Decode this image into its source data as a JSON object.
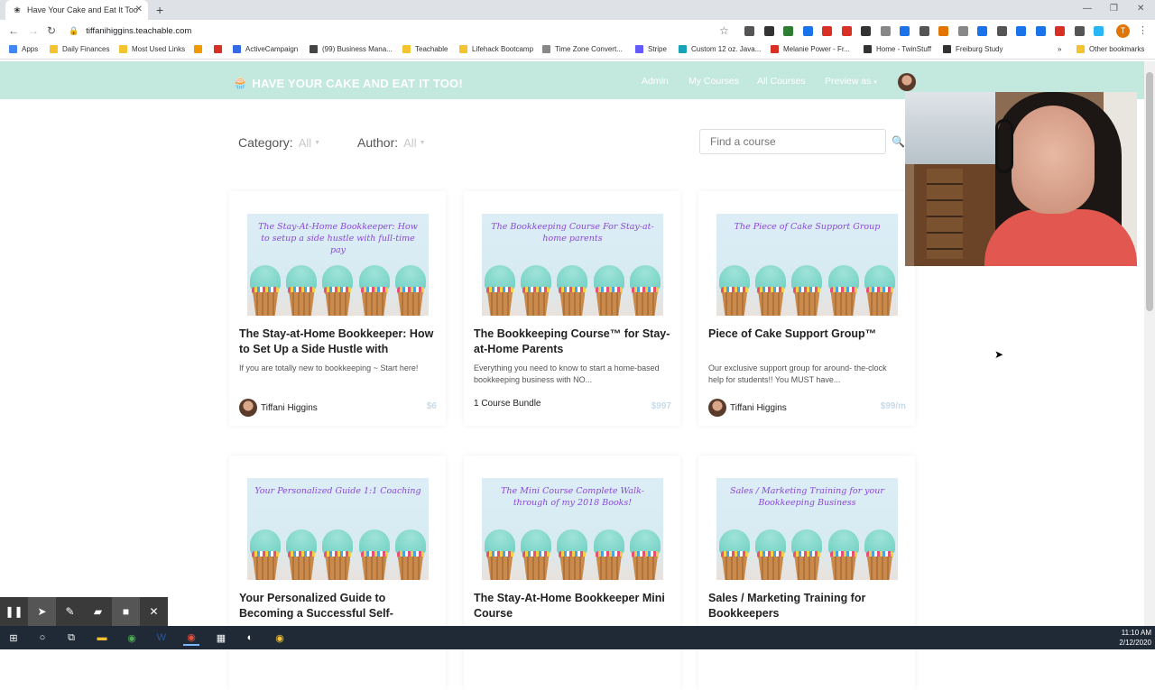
{
  "browser": {
    "tab_title": "Have Your Cake and Eat It Too",
    "url": "tiffanihiggins.teachable.com",
    "profile_initial": "T",
    "bookmarks": [
      {
        "label": "Apps",
        "color": "#4285f4"
      },
      {
        "label": "Daily Finances",
        "color": "#f4c430"
      },
      {
        "label": "Most Used Links",
        "color": "#f4c430"
      },
      {
        "label": "",
        "color": "#f29900"
      },
      {
        "label": "",
        "color": "#d93025"
      },
      {
        "label": "ActiveCampaign",
        "color": "#356ae6"
      },
      {
        "label": "(99) Business Mana...",
        "color": "#444444"
      },
      {
        "label": "Teachable",
        "color": "#f4c430"
      },
      {
        "label": "Lifehack Bootcamp",
        "color": "#f4c430"
      },
      {
        "label": "Time Zone Convert...",
        "color": "#888888"
      },
      {
        "label": "Stripe",
        "color": "#635bff"
      },
      {
        "label": "Custom 12 oz. Java...",
        "color": "#17a2b8"
      },
      {
        "label": "Melanie Power - Fr...",
        "color": "#d93025"
      },
      {
        "label": "Home - TwinStuff",
        "color": "#333333"
      },
      {
        "label": "Freiburg Study",
        "color": "#333333"
      },
      {
        "label": "Other bookmarks",
        "color": "#f4c430"
      }
    ]
  },
  "site": {
    "brand": "HAVE YOUR CAKE AND EAT IT TOO!",
    "nav": [
      "Admin",
      "My Courses",
      "All Courses",
      "Preview as"
    ],
    "accent": "#c3e8de"
  },
  "filters": {
    "category_label": "Category:",
    "category_value": "All",
    "author_label": "Author:",
    "author_value": "All",
    "search_placeholder": "Find a course"
  },
  "courses": [
    {
      "thumb": "The Stay-At-Home Bookkeeper: How to setup a side hustle with full-time pay",
      "title": "The Stay-at-Home Bookkeeper: How to Set Up a Side Hustle with",
      "desc": "If you are totally new to bookkeeping ~ Start here!",
      "author": "Tiffani Higgins",
      "price": "$6"
    },
    {
      "thumb": "The Bookkeeping Course For Stay-at-home parents",
      "title": "The Bookkeeping Course™ for Stay-at-Home Parents",
      "desc": "Everything you need to know to start a home-based bookkeeping business with NO...",
      "author": "1 Course Bundle",
      "price": "$997"
    },
    {
      "thumb": "The Piece of Cake Support Group",
      "title": "Piece of Cake Support Group™",
      "desc": "Our exclusive support group for around- the-clock help for students!! You MUST have...",
      "author": "Tiffani Higgins",
      "price": "$99/m"
    },
    {
      "thumb": "Your Personalized Guide 1:1 Coaching",
      "title": "Your Personalized Guide to Becoming a Successful Self-",
      "desc": "",
      "author": "",
      "price": ""
    },
    {
      "thumb": "The Mini Course Complete Walk-through of my 2018 Books!",
      "title": "The Stay-At-Home Bookkeeper Mini Course",
      "desc": "",
      "author": "",
      "price": ""
    },
    {
      "thumb": "Sales / Marketing Training for your Bookkeeping Business",
      "title": "Sales / Marketing Training for Bookkeepers",
      "desc": "",
      "author": "",
      "price": ""
    }
  ],
  "taskbar": {
    "time": "11:10 AM",
    "date": "2/12/2020"
  }
}
